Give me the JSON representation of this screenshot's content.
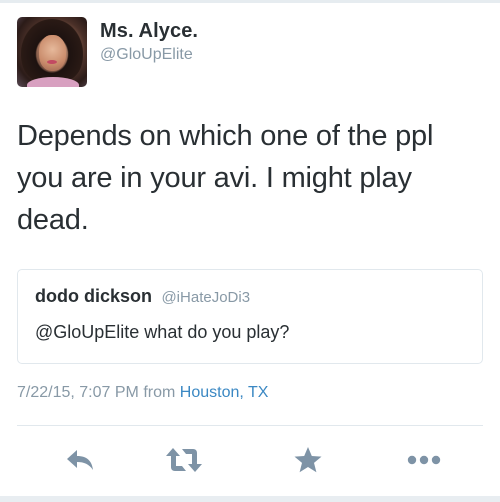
{
  "tweet": {
    "author": {
      "display_name": "Ms. Alyce.",
      "handle": "@GloUpElite"
    },
    "text": "Depends on which one of the ppl you are in your avi. I might play dead.",
    "quoted": {
      "author_name": "dodo dickson",
      "author_handle": "@iHateJoDi3",
      "text": "@GloUpElite what do you play?"
    },
    "meta": {
      "timestamp": "7/22/15, 7:07 PM",
      "from_label": "from",
      "location": "Houston, TX"
    }
  },
  "actions": [
    {
      "name": "reply",
      "icon": "reply-icon"
    },
    {
      "name": "retweet",
      "icon": "retweet-icon"
    },
    {
      "name": "favorite",
      "icon": "star-icon"
    },
    {
      "name": "more",
      "icon": "more-dots-icon"
    }
  ],
  "colors": {
    "text": "#292f33",
    "muted": "#8899a6",
    "link": "#3b88c3",
    "icon": "#7e93a6",
    "border": "#e1e8ed"
  }
}
